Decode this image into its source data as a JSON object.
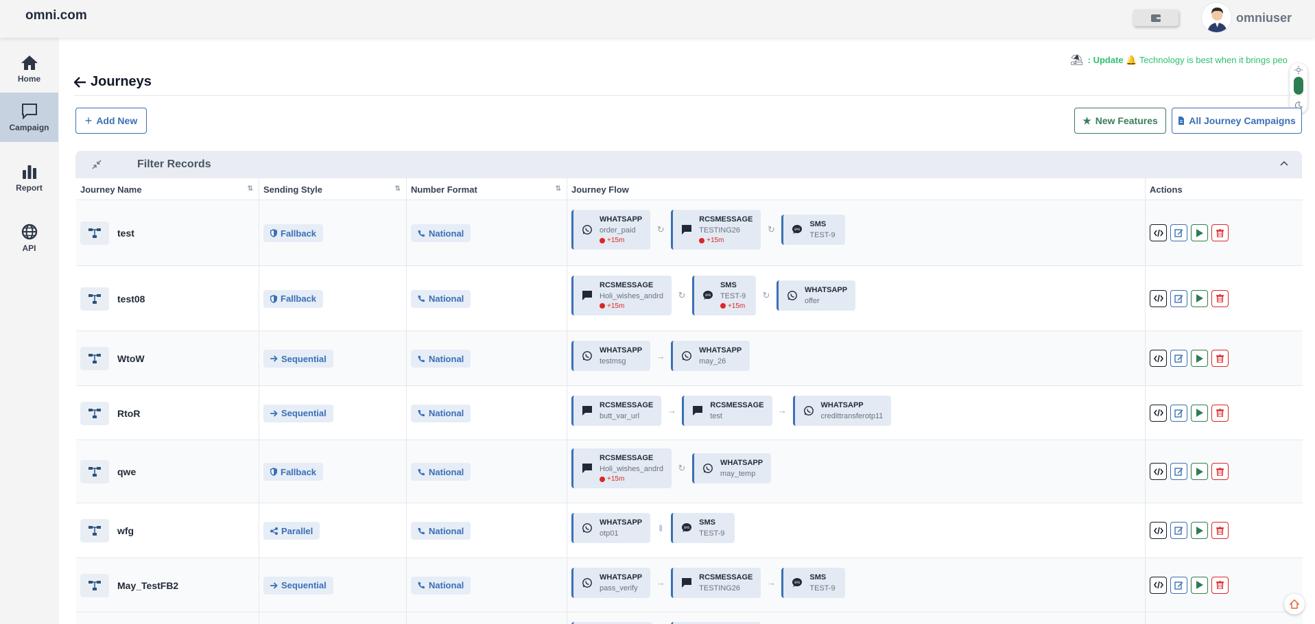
{
  "brand": "omni.com",
  "user": {
    "name": "omniuser"
  },
  "sidebar": {
    "items": [
      {
        "label": "Home",
        "icon": "home-icon"
      },
      {
        "label": "Campaign",
        "icon": "chat-icon"
      },
      {
        "label": "Report",
        "icon": "bar-chart-icon"
      },
      {
        "label": "API",
        "icon": "globe-icon"
      }
    ]
  },
  "notice": {
    "prefix": ": Update",
    "text": "Technology is best when it brings peo"
  },
  "page": {
    "title": "Journeys"
  },
  "toolbar": {
    "add_new": "Add New",
    "new_features": "New Features",
    "all_campaigns": "All Journey Campaigns"
  },
  "filter": {
    "title": "Filter Records"
  },
  "table": {
    "headers": [
      "Journey Name",
      "Sending Style",
      "Number Format",
      "Journey Flow",
      "Actions"
    ],
    "rows": [
      {
        "name": "test",
        "style": "Fallback",
        "format": "National",
        "steps": [
          {
            "channel": "WHATSAPP",
            "template": "order_paid",
            "delay": "+15m"
          },
          {
            "channel": "RCSMESSAGE",
            "template": "TESTING26",
            "delay": "+15m"
          },
          {
            "channel": "SMS",
            "template": "TEST-9"
          }
        ]
      },
      {
        "name": "test08",
        "style": "Fallback",
        "format": "National",
        "steps": [
          {
            "channel": "RCSMESSAGE",
            "template": "Holi_wishes_andrd",
            "delay": "+15m"
          },
          {
            "channel": "SMS",
            "template": "TEST-9",
            "delay": "+15m"
          },
          {
            "channel": "WHATSAPP",
            "template": "offer"
          }
        ]
      },
      {
        "name": "WtoW",
        "style": "Sequential",
        "format": "National",
        "steps": [
          {
            "channel": "WHATSAPP",
            "template": "testmsg"
          },
          {
            "channel": "WHATSAPP",
            "template": "may_26"
          }
        ]
      },
      {
        "name": "RtoR",
        "style": "Sequential",
        "format": "National",
        "steps": [
          {
            "channel": "RCSMESSAGE",
            "template": "butt_var_url"
          },
          {
            "channel": "RCSMESSAGE",
            "template": "test"
          },
          {
            "channel": "WHATSAPP",
            "template": "credittransferotp11"
          }
        ]
      },
      {
        "name": "qwe",
        "style": "Fallback",
        "format": "National",
        "steps": [
          {
            "channel": "RCSMESSAGE",
            "template": "Holi_wishes_andrd",
            "delay": "+15m"
          },
          {
            "channel": "WHATSAPP",
            "template": "may_temp"
          }
        ]
      },
      {
        "name": "wfg",
        "style": "Parallel",
        "format": "National",
        "steps": [
          {
            "channel": "WHATSAPP",
            "template": "otp01"
          },
          {
            "channel": "SMS",
            "template": "TEST-9"
          }
        ]
      },
      {
        "name": "May_TestFB2",
        "style": "Sequential",
        "format": "National",
        "steps": [
          {
            "channel": "WHATSAPP",
            "template": "pass_verify"
          },
          {
            "channel": "RCSMESSAGE",
            "template": "TESTING26"
          },
          {
            "channel": "SMS",
            "template": "TEST-9"
          }
        ]
      }
    ]
  },
  "colors": {
    "primary": "#3b6fb6",
    "success": "#2e7d52",
    "danger": "#dc2626",
    "notice": "#2fbf71"
  }
}
